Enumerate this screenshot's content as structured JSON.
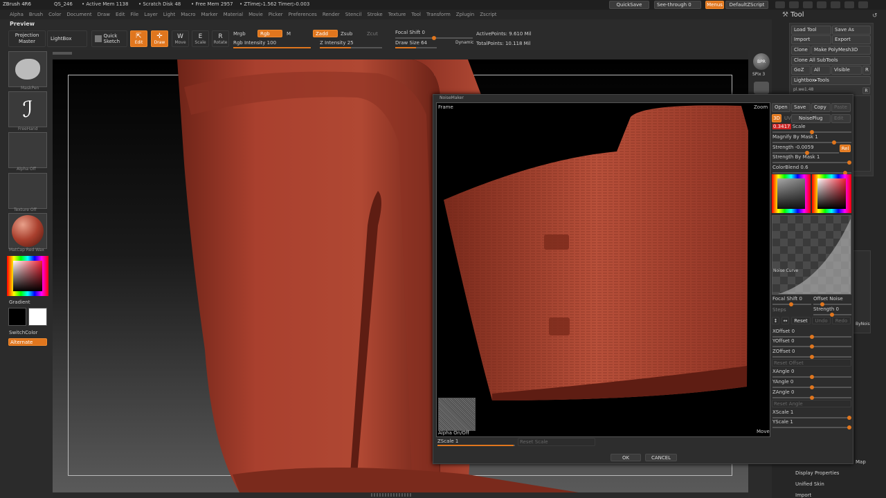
{
  "titlebar": {
    "app": "ZBrush 4R6",
    "info": [
      "QS_246",
      "• Active Mem 1138",
      "• Scratch Disk 48",
      "• Free Mem 2957",
      "• ZTime▷1.562 Timer▷0.003"
    ],
    "quicksave": "QuickSave",
    "see_through": "See-through  0",
    "menus": "Menus",
    "default_zscript": "DefaultZScript"
  },
  "menubar": [
    "Alpha",
    "Brush",
    "Color",
    "Document",
    "Draw",
    "Edit",
    "File",
    "Layer",
    "Light",
    "Macro",
    "Marker",
    "Material",
    "Movie",
    "Picker",
    "Preferences",
    "Render",
    "Stencil",
    "Stroke",
    "Texture",
    "Tool",
    "Transform",
    "Zplugin",
    "Zscript"
  ],
  "preview_label": "Preview",
  "toolbar": {
    "projection_master": "Projection Master",
    "lightbox": "LightBox",
    "quick_sketch": "Quick Sketch",
    "edit": "Edit",
    "draw": "Draw",
    "move": "Move",
    "scale": "Scale",
    "rotate": "Rotate",
    "mrgb": "Mrgb",
    "rgb": "Rgb",
    "m": "M",
    "zadd": "Zadd",
    "zsub": "Zsub",
    "zcut": "Zcut",
    "rgb_intensity": "Rgb Intensity 100",
    "z_intensity": "Z Intensity 25",
    "focal_shift": "Focal Shift 0",
    "draw_size": "Draw Size 64",
    "dynamic": "Dynamic",
    "active_points": "ActivePoints: 9.610  Mil",
    "total_points": "TotalPoints: 10.118  Mil"
  },
  "left_shelf": {
    "brush_label": "MaskPen",
    "stroke_label": "FreeHand",
    "alpha_label": "Alpha  Off",
    "texture_label": "Texture  Off",
    "material_label": "MatCap Red Wax",
    "gradient": "Gradient",
    "switch_color": "SwitchColor",
    "alternate": "Alternate"
  },
  "right_shelf": {
    "bpr": "BPR",
    "spix": "SPix 3"
  },
  "tool_panel": {
    "title": "Tool",
    "buttons": [
      "Load Tool",
      "Save As",
      "Import",
      "Export",
      "Clone",
      "Make PolyMesh3D",
      "Clone All SubTools",
      "GoZ",
      "All",
      "Visible",
      "R",
      "Lightbox▸Tools"
    ],
    "pl_label": "pl.we1.48",
    "r_btn": "R",
    "bynoise": "ByNois",
    "map": "Map",
    "bottom_items": [
      "Display Properties",
      "Unified Skin",
      "Import"
    ]
  },
  "noisemaker": {
    "title": "NoiseMaker",
    "frame": "Frame",
    "zoom": "Zoom",
    "move": "Move",
    "alpha_onoff": "Alpha On/Off",
    "zscale": "ZScale 1",
    "reset_scale": "Reset Scale",
    "ok": "OK",
    "cancel": "CANCEL",
    "top_buttons": [
      "Open",
      "Save",
      "Copy",
      "Paste"
    ],
    "b3d": "3D",
    "uv": "UV",
    "noiseplug": "NoisePlug",
    "edit": "Edit",
    "scale_value": "0.3417",
    "scale_label": "Scale",
    "magnify_by_mask": "Magnify By Mask 1",
    "strength": "Strength -0.0059",
    "rel": "Rel",
    "strength_by_mask": "Strength By Mask 1",
    "colorblend": "ColorBlend 0.6",
    "noise_curve": "Noise Curve",
    "focal_shift": "Focal Shift 0",
    "offset_noise": "Offset Noise",
    "steps": "Steps",
    "strength2": "Strength 0",
    "reset": "Reset",
    "undo": "Undo",
    "redo": "Redo",
    "xoffset": "XOffset 0",
    "yoffset": "YOffset 0",
    "zoffset": "ZOffset 0",
    "reset_offset": "Reset Offset",
    "xangle": "XAngle 0",
    "yangle": "YAngle 0",
    "zangle": "ZAngle 0",
    "reset_angle": "Reset Angle",
    "xscale": "XScale 1",
    "yscale": "YScale 1"
  },
  "colors": {
    "accent": "#e0761e",
    "clay": "#a9402e",
    "ui_bg": "#2a2a2a"
  }
}
